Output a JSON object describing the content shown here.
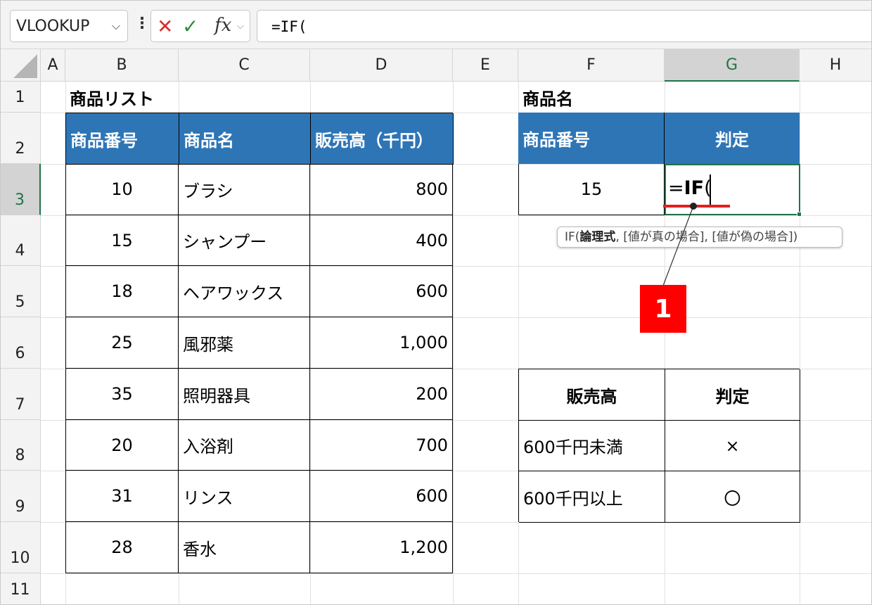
{
  "formula_bar": {
    "name_box": "VLOOKUP",
    "formula": "=IF("
  },
  "columns": [
    "A",
    "B",
    "C",
    "D",
    "E",
    "F",
    "G",
    "H"
  ],
  "rows": [
    "1",
    "2",
    "3",
    "4",
    "5",
    "6",
    "7",
    "8",
    "9",
    "10",
    "11"
  ],
  "product_list": {
    "title": "商品リスト",
    "headers": [
      "商品番号",
      "商品名",
      "販売高（千円）"
    ],
    "rows": [
      [
        "10",
        "ブラシ",
        "800"
      ],
      [
        "15",
        "シャンプー",
        "400"
      ],
      [
        "18",
        "ヘアワックス",
        "600"
      ],
      [
        "25",
        "風邪薬",
        "1,000"
      ],
      [
        "35",
        "照明器具",
        "200"
      ],
      [
        "20",
        "入浴剤",
        "700"
      ],
      [
        "31",
        "リンス",
        "600"
      ],
      [
        "28",
        "香水",
        "1,200"
      ]
    ]
  },
  "lookup": {
    "title": "商品名",
    "headers": [
      "商品番号",
      "判定"
    ],
    "product_number": "15",
    "editing_formula": "=IF("
  },
  "criteria": {
    "headers": [
      "販売高",
      "判定"
    ],
    "rows": [
      [
        "600千円未満",
        "×"
      ],
      [
        "600千円以上",
        "〇"
      ]
    ]
  },
  "tooltip": {
    "function": "IF(",
    "arg_current": "論理式",
    "rest": ", [値が真の場合], [値が偽の場合])"
  },
  "callout": {
    "label": "1",
    "color": "#ff0000"
  },
  "colors": {
    "header_fill": "#2e75b6",
    "selection": "#217346"
  }
}
